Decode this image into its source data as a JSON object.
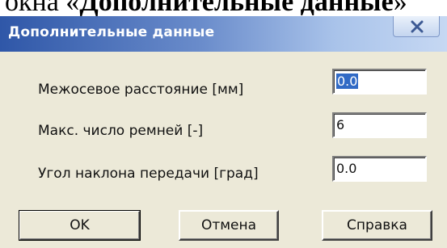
{
  "caption": {
    "prefix": "окна «",
    "bold": "Дополнительные данные",
    "suffix": "»"
  },
  "window": {
    "title": "Дополнительные данные",
    "close_icon": "close-icon"
  },
  "fields": [
    {
      "label": "Межосевое расстояние  [мм]",
      "value": "0.0",
      "selected": true
    },
    {
      "label": "Макс. число ремней  [-]",
      "value": "6",
      "selected": false
    },
    {
      "label": "Угол наклона передачи  [град]",
      "value": "0.0",
      "selected": false
    }
  ],
  "buttons": {
    "ok": "OK",
    "cancel": "Отмена",
    "help": "Справка"
  }
}
